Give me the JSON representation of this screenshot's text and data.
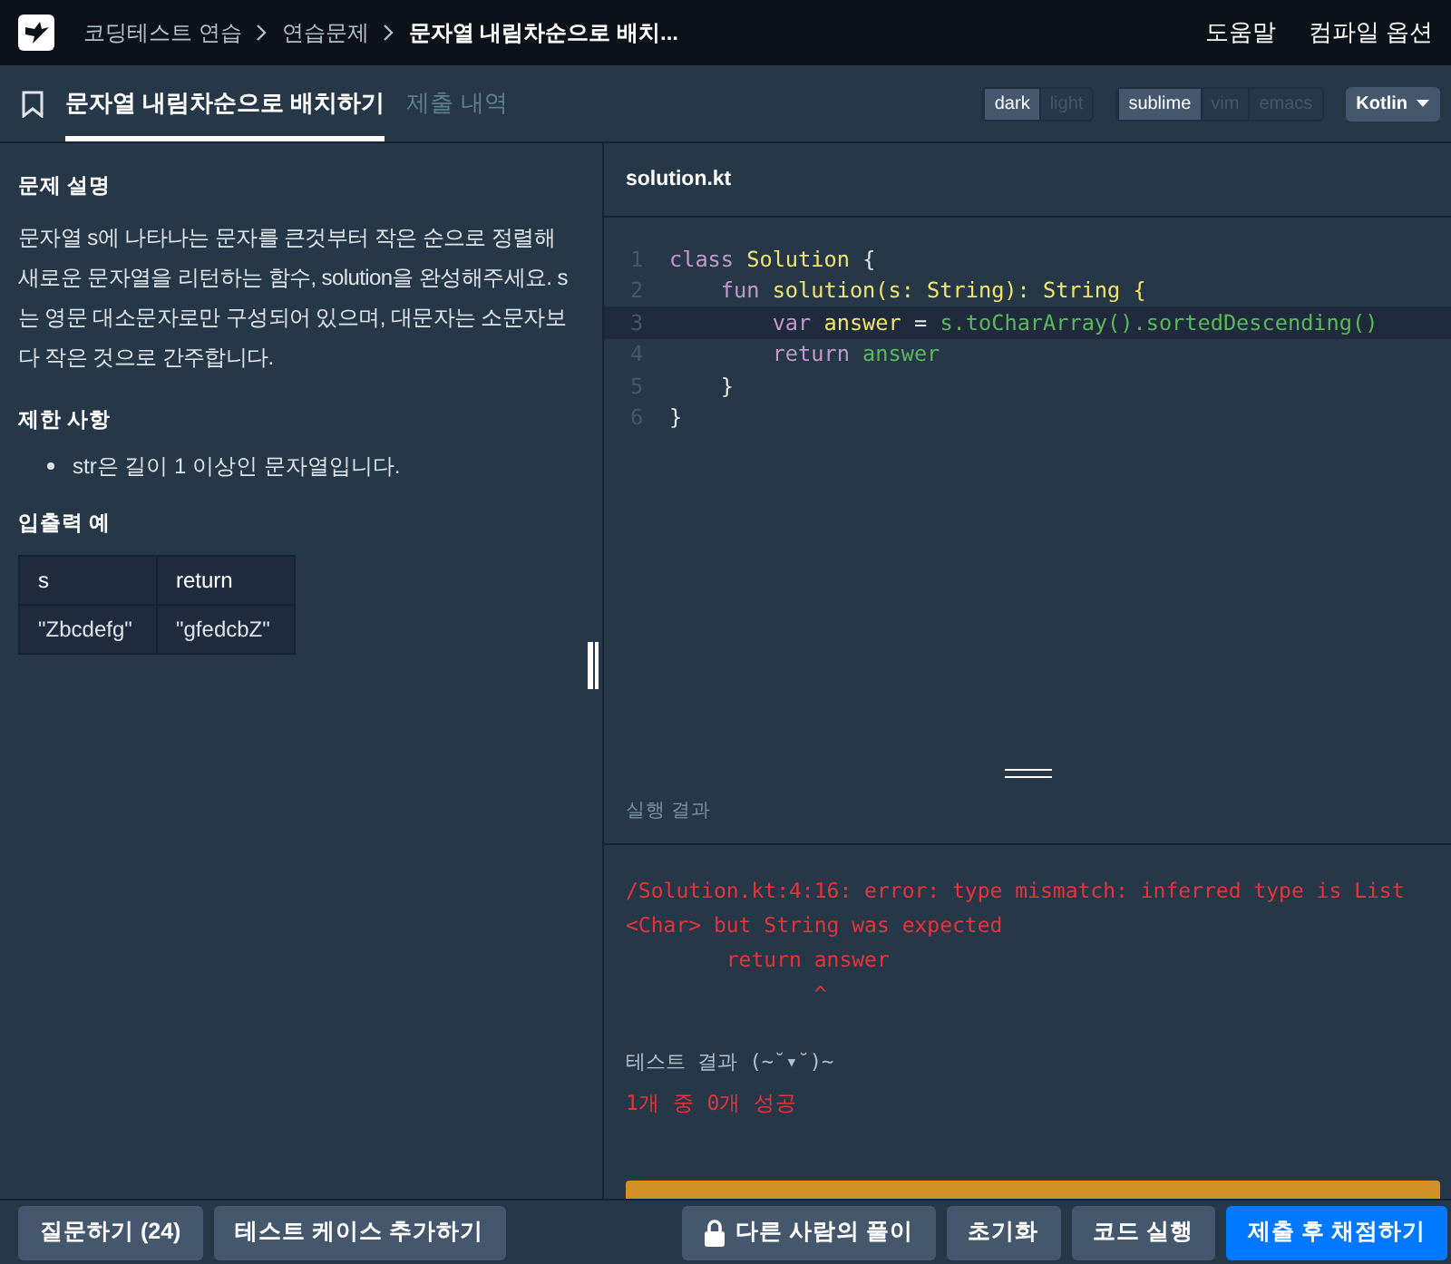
{
  "breadcrumb": [
    "코딩테스트 연습",
    "연습문제",
    "문자열 내림차순으로 배치..."
  ],
  "header_links": [
    "도움말",
    "컴파일 옵션"
  ],
  "tabs": [
    {
      "label": "문자열 내림차순으로 배치하기",
      "selected": true
    },
    {
      "label": "제출 내역",
      "selected": false
    }
  ],
  "theme_toggle": [
    {
      "label": "dark",
      "selected": true
    },
    {
      "label": "light",
      "selected": false
    }
  ],
  "keymap_toggle": [
    {
      "label": "sublime",
      "selected": true
    },
    {
      "label": "vim",
      "selected": false
    },
    {
      "label": "emacs",
      "selected": false
    }
  ],
  "language_dropdown": "Kotlin",
  "problem": {
    "description_heading": "문제 설명",
    "description": "문자열 s에 나타나는 문자를 큰것부터 작은 순으로 정렬해 새로운 문자열을 리턴하는 함수, solution을 완성해주세요. s는 영문 대소문자로만 구성되어 있으며, 대문자는 소문자보다 작은 것으로 간주합니다.",
    "constraints_heading": "제한 사항",
    "constraints": [
      "str은 길이 1 이상인 문자열입니다."
    ],
    "examples_heading": "입출력 예",
    "examples_table": {
      "columns": [
        "s",
        "return"
      ],
      "rows": [
        [
          "\"Zbcdefg\"",
          "\"gfedcbZ\""
        ]
      ]
    }
  },
  "editor": {
    "filename": "solution.kt",
    "lines": [
      {
        "number": "1",
        "active": false,
        "tokens": [
          {
            "kind": "keyword",
            "text": "class"
          },
          {
            "kind": "type",
            "text": "Solution"
          },
          {
            "kind": "plain",
            "text": "{"
          }
        ]
      },
      {
        "number": "2",
        "active": false,
        "tokens": [
          {
            "kind": "keyword",
            "text": "    fun"
          },
          {
            "kind": "type",
            "text": "solution(s: String): String {"
          }
        ]
      },
      {
        "number": "3",
        "active": true,
        "tokens": [
          {
            "kind": "keyword",
            "text": "        var"
          },
          {
            "kind": "type",
            "text": "answer"
          },
          {
            "kind": "plain",
            "text": "="
          },
          {
            "kind": "method",
            "text": "s.toCharArray().sortedDescending()"
          }
        ]
      },
      {
        "number": "4",
        "active": false,
        "tokens": [
          {
            "kind": "keyword",
            "text": "        return"
          },
          {
            "kind": "method",
            "text": "answer"
          }
        ]
      },
      {
        "number": "5",
        "active": false,
        "tokens": [
          {
            "kind": "plain",
            "text": "    }"
          }
        ]
      },
      {
        "number": "6",
        "active": false,
        "tokens": [
          {
            "kind": "plain",
            "text": "}"
          }
        ]
      }
    ]
  },
  "result": {
    "heading": "실행 결과",
    "error_lines": [
      "/Solution.kt:4:16: error: type mismatch: inferred type is List",
      "<Char> but String was expected",
      "        return answer",
      "               ^"
    ],
    "test_result_label": "테스트 결과 (~˘▾˘)~",
    "test_summary": "1개 중 0개 성공"
  },
  "bottom_left_buttons": [
    "질문하기 (24)",
    "테스트 케이스 추가하기"
  ],
  "bottom_right_buttons": [
    {
      "kind": "locked",
      "label": "다른 사람의 풀이"
    },
    {
      "kind": "normal",
      "label": "초기화"
    },
    {
      "kind": "normal",
      "label": "코드 실행"
    },
    {
      "kind": "primary",
      "label": "제출 후 채점하기"
    }
  ]
}
